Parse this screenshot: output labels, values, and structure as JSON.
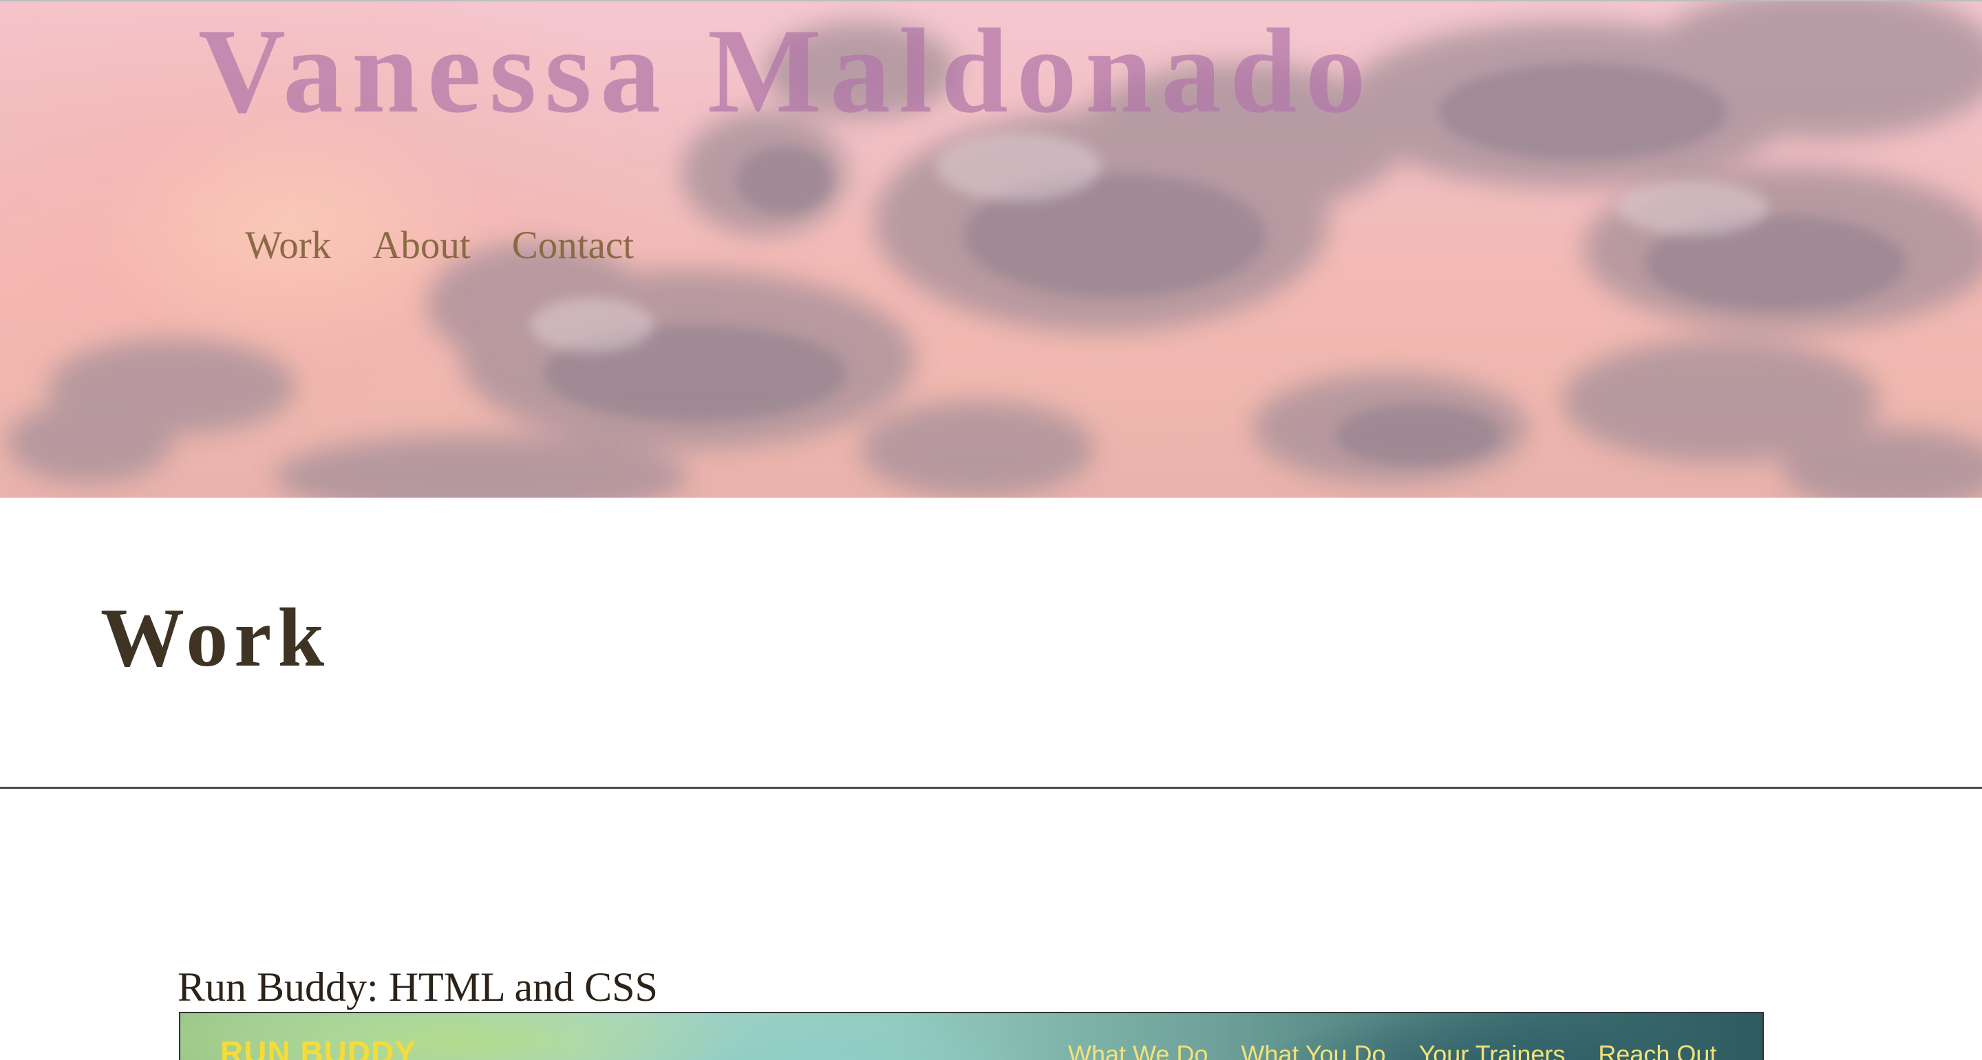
{
  "header": {
    "site_title": "Vanessa Maldonado",
    "nav": [
      {
        "label": "Work"
      },
      {
        "label": "About"
      },
      {
        "label": "Contact"
      }
    ]
  },
  "work_section": {
    "heading": "Work"
  },
  "projects": [
    {
      "title": "Run Buddy: HTML and CSS",
      "screenshot": {
        "brand": "RUN BUDDY",
        "nav": [
          "What We Do",
          "What You Do",
          "Your Trainers",
          "Reach Out"
        ]
      }
    }
  ],
  "colors": {
    "site_title": "#b176a8",
    "nav_link": "#8a6a45",
    "section_heading": "#3f3324",
    "divider": "#4a4a4a",
    "shot_brand": "#f5dc3a"
  }
}
